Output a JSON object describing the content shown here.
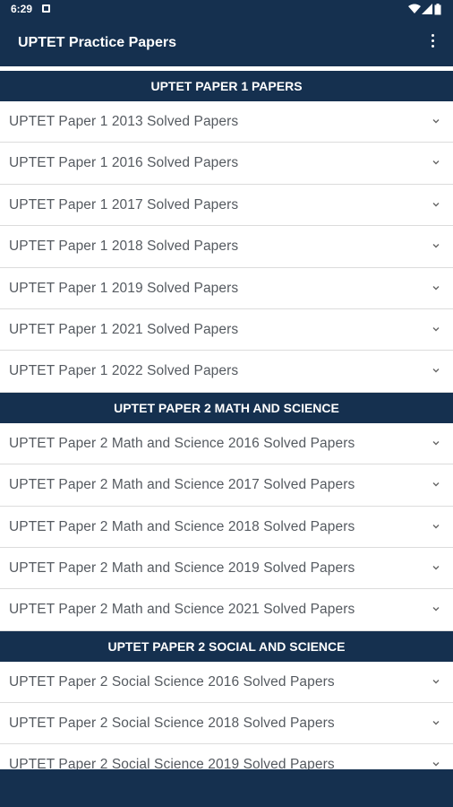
{
  "status_bar": {
    "time": "6:29"
  },
  "app_bar": {
    "title": "UPTET Practice Papers"
  },
  "sections": [
    {
      "title": "UPTET PAPER 1 PAPERS",
      "items": [
        "UPTET Paper 1 2013 Solved Papers",
        "UPTET Paper 1 2016 Solved Papers",
        "UPTET Paper 1 2017 Solved Papers",
        "UPTET Paper 1 2018 Solved Papers",
        "UPTET Paper 1 2019 Solved Papers",
        "UPTET Paper 1 2021 Solved Papers",
        "UPTET Paper 1 2022 Solved Papers"
      ]
    },
    {
      "title": "UPTET PAPER 2 MATH AND SCIENCE",
      "items": [
        "UPTET Paper 2 Math and Science 2016 Solved Papers",
        "UPTET Paper 2 Math and Science 2017 Solved Papers",
        "UPTET Paper 2 Math and Science 2018 Solved Papers",
        "UPTET Paper 2 Math and Science 2019 Solved Papers",
        "UPTET Paper 2 Math and Science 2021 Solved Papers"
      ]
    },
    {
      "title": "UPTET PAPER 2 SOCIAL AND SCIENCE",
      "items": [
        "UPTET Paper 2 Social Science 2016 Solved Papers",
        "UPTET Paper 2 Social Science 2018 Solved Papers",
        "UPTET Paper 2 Social Science 2019 Solved Papers"
      ]
    }
  ],
  "colors": {
    "primary": "#15304f",
    "divider": "#dcdcdc",
    "item_text": "#555a60"
  },
  "icons": {
    "expand": "chevron-down-icon",
    "overflow": "more-vert-icon"
  }
}
